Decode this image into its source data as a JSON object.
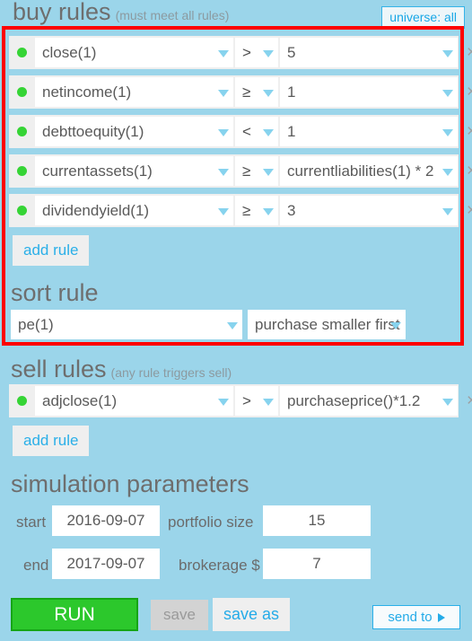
{
  "buy": {
    "title": "buy rules",
    "hint": "(must meet all rules)",
    "universe_badge": "universe: all",
    "add_rule_label": "add rule",
    "rules": [
      {
        "field": "close(1)",
        "op": ">",
        "value": "5",
        "status": "active",
        "remove": "×"
      },
      {
        "field": "netincome(1)",
        "op": "≥",
        "value": "1",
        "status": "active",
        "remove": "×"
      },
      {
        "field": "debttoequity(1)",
        "op": "<",
        "value": "1",
        "status": "active",
        "remove": "×"
      },
      {
        "field": "currentassets(1)",
        "op": "≥",
        "value": "currentliabilities(1) * 2",
        "status": "active",
        "remove": "×"
      },
      {
        "field": "dividendyield(1)",
        "op": "≥",
        "value": "3",
        "status": "active",
        "remove": "×"
      }
    ]
  },
  "sort": {
    "title": "sort rule",
    "field": "pe(1)",
    "direction": "purchase smaller first"
  },
  "sell": {
    "title": "sell rules",
    "hint": "(any rule triggers sell)",
    "add_rule_label": "add rule",
    "rules": [
      {
        "field": "adjclose(1)",
        "op": ">",
        "value": "purchaseprice()*1.2",
        "status": "active",
        "remove": "×"
      }
    ]
  },
  "simulation": {
    "title": "simulation parameters",
    "start_label": "start",
    "start_value": "2016-09-07",
    "end_label": "end",
    "end_value": "2017-09-07",
    "portfolio_label": "portfolio size",
    "portfolio_value": "15",
    "brokerage_label": "brokerage $",
    "brokerage_value": "7"
  },
  "actions": {
    "run": "RUN",
    "save": "save",
    "save_as": "save as",
    "send_to": "send to"
  },
  "colors": {
    "background": "#9bd5ea",
    "accent_blue": "#24abe8",
    "run_green": "#2cc82c",
    "status_dot_green": "#35d435",
    "highlight_red": "#ff0000",
    "caret_blue": "#87d3ee"
  }
}
